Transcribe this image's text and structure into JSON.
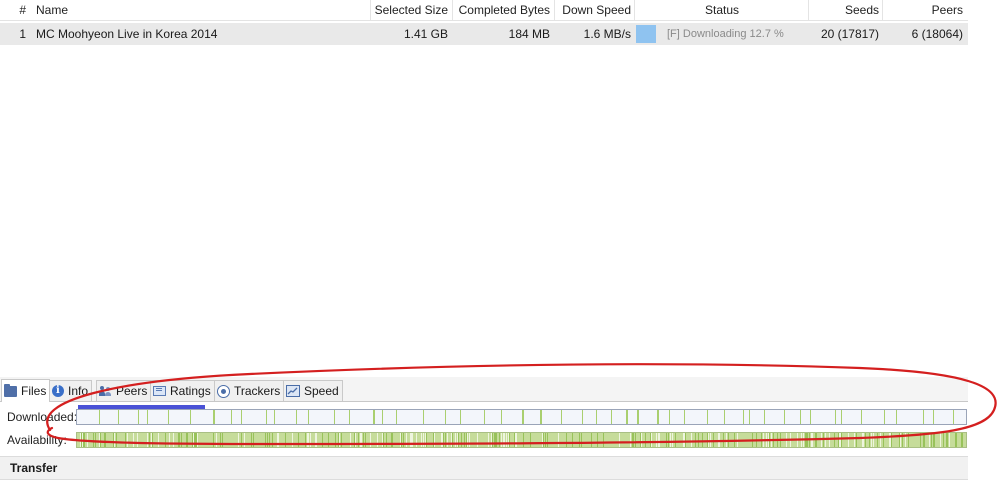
{
  "table": {
    "headers": {
      "num": "#",
      "name": "Name",
      "selected_size": "Selected Size",
      "completed_bytes": "Completed Bytes",
      "down_speed": "Down Speed",
      "status": "Status",
      "seeds": "Seeds",
      "peers": "Peers"
    },
    "rows": [
      {
        "num": "1",
        "name": "MC Moohyeon Live in Korea 2014",
        "selected_size": "1.41 GB",
        "completed_bytes": "184 MB",
        "down_speed": "1.6 MB/s",
        "status": "[F] Downloading 12.7 %",
        "progress": 0.127,
        "seeds": "20 (17817)",
        "peers": "6 (18064)"
      }
    ]
  },
  "tabs": [
    {
      "label": "Files",
      "icon": "folder-icon",
      "active": true
    },
    {
      "label": "Info",
      "icon": "info-icon"
    },
    {
      "label": "Peers",
      "icon": "peers-icon"
    },
    {
      "label": "Ratings",
      "icon": "ratings-icon"
    },
    {
      "label": "Trackers",
      "icon": "trackers-icon"
    },
    {
      "label": "Speed",
      "icon": "speed-icon"
    }
  ],
  "pieces": {
    "downloaded_label": "Downloaded:",
    "availability_label": "Availability:",
    "downloaded_fraction": 0.127
  },
  "transfer": {
    "title": "Transfer"
  },
  "colors": {
    "row_bg": "#e9e9e9",
    "progress_fill": "#8fc3f0",
    "piece_green": "#a9cf6f",
    "sequential_strip": "#4a52d6",
    "annotation_red": "#d41f1f"
  }
}
